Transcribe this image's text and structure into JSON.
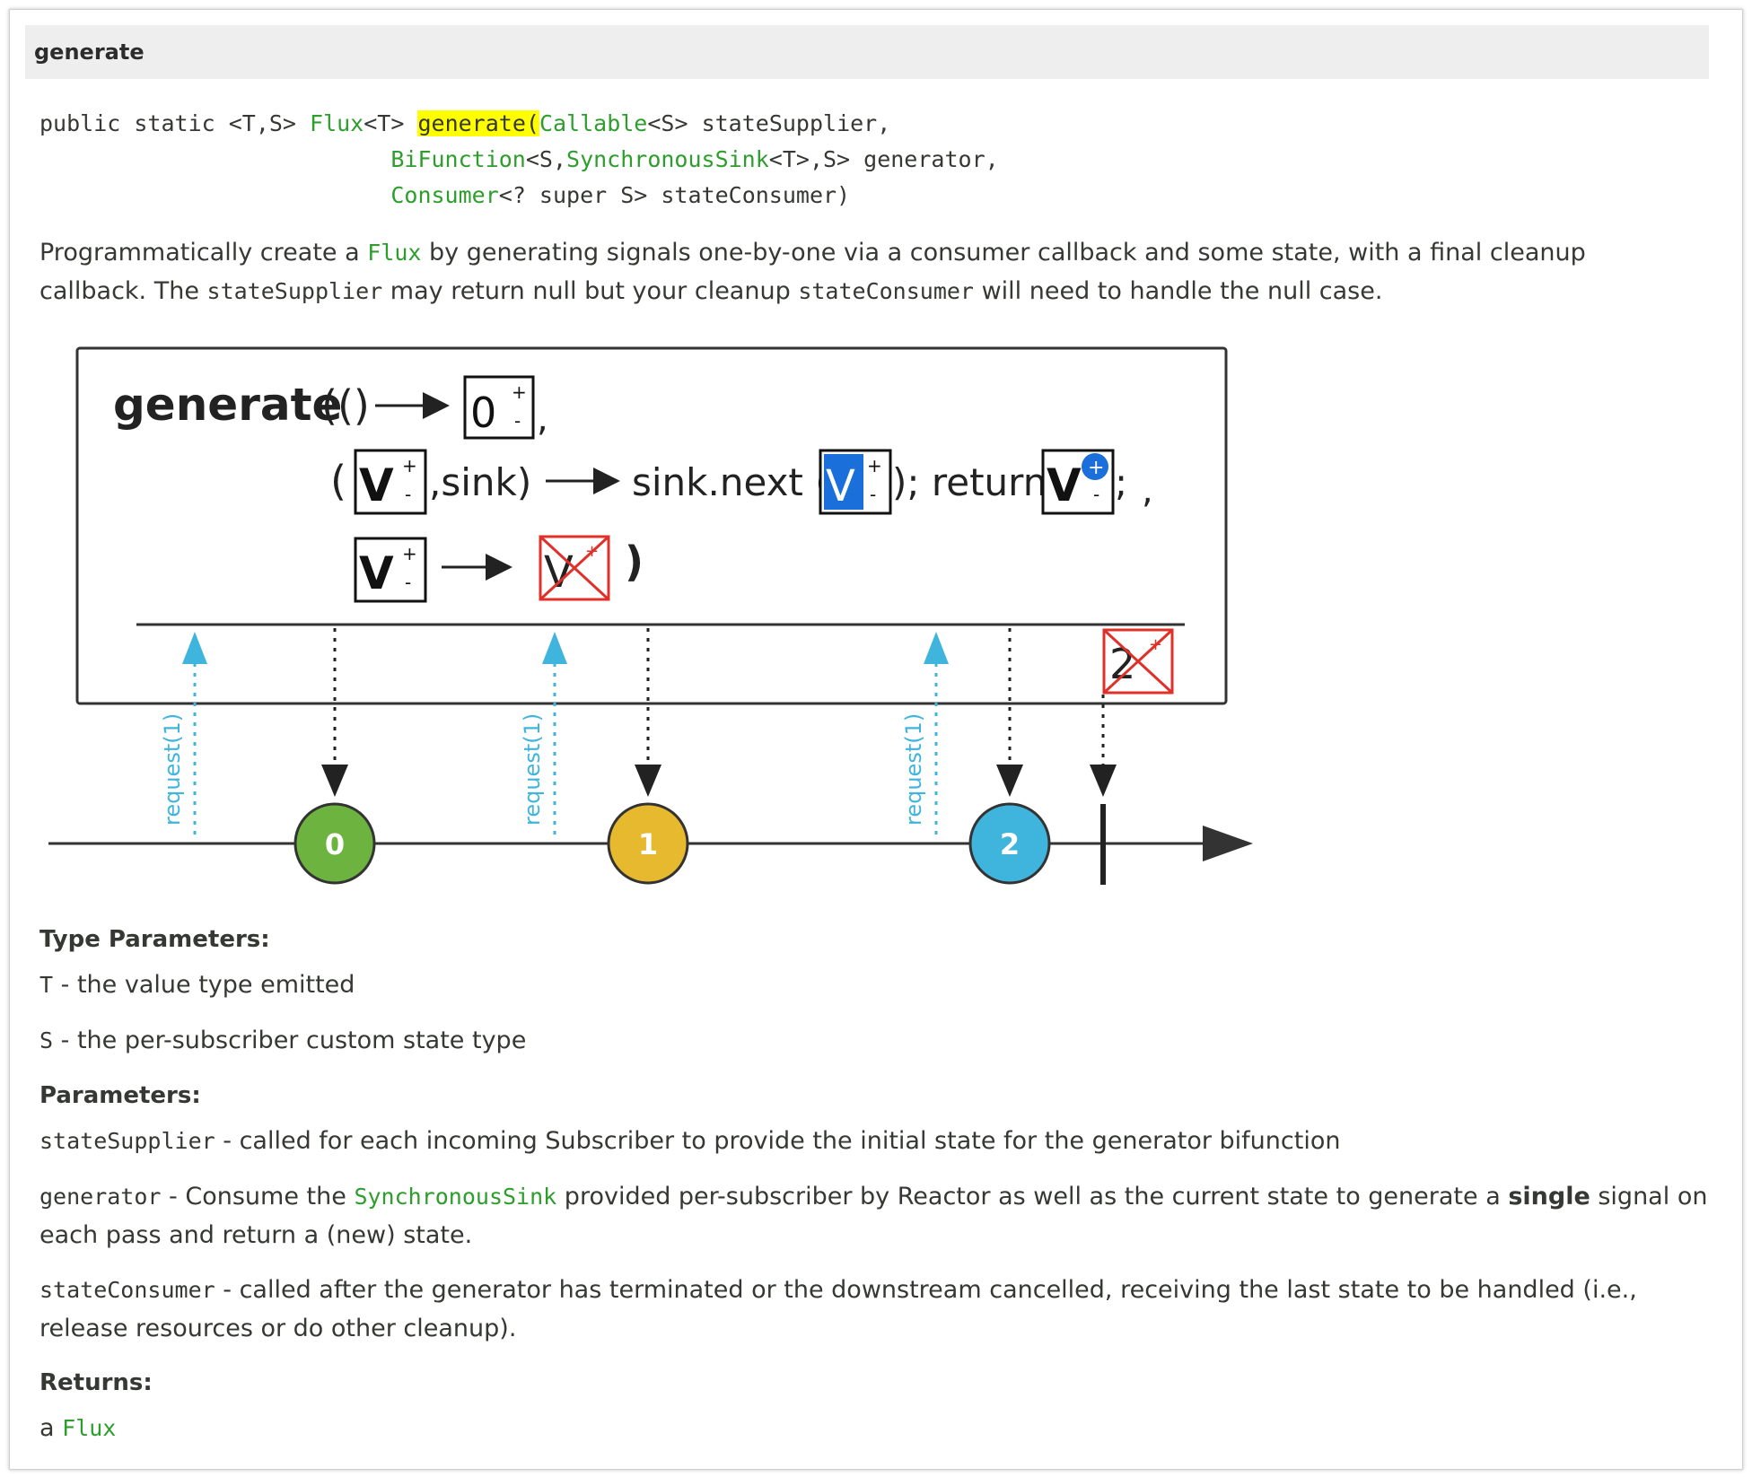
{
  "header": {
    "title": "generate"
  },
  "signature": {
    "prefix": "public static <T,S> ",
    "return_type": "Flux",
    "return_generic": "<T> ",
    "method_name": "generate(",
    "param1_type": "Callable",
    "param1_rest": "<S> stateSupplier,",
    "param2_type": "BiFunction",
    "param2_mid": "<S,",
    "param2_type2": "SynchronousSink",
    "param2_rest": "<T>,S> generator,",
    "param3_type": "Consumer",
    "param3_rest": "<? super S> stateConsumer)"
  },
  "description": {
    "part1": "Programmatically create a ",
    "flux": "Flux",
    "part2": " by generating signals one-by-one via a consumer callback and some state, with a final cleanup callback. The ",
    "code1": "stateSupplier",
    "part3": " may return null but your cleanup ",
    "code2": "stateConsumer",
    "part4": " will need to handle the null case."
  },
  "marble": {
    "title": "generate",
    "open_paren": "(()",
    "state_initial": "0",
    "plus": "+",
    "minus": "-",
    "comma": ",",
    "line2_open": "(",
    "v": "V",
    "sink": ",sink)",
    "sink_next": "sink.next (",
    "return_text": "); return",
    "semicolon": ";",
    "close_paren": ")",
    "request_label": "request(1)",
    "terminated_value": "2",
    "emissions": [
      "0",
      "1",
      "2"
    ],
    "colors": {
      "green": "#6db33f",
      "yellow": "#e6b92f",
      "blue": "#3fb4dd",
      "request": "#3fb4dd",
      "cancel": "#e0302a",
      "highlight_box": "#1a6fdb"
    }
  },
  "type_parameters": {
    "heading": "Type Parameters:",
    "items": [
      {
        "name": "T",
        "text": " - the value type emitted"
      },
      {
        "name": "S",
        "text": " - the per-subscriber custom state type"
      }
    ]
  },
  "parameters": {
    "heading": "Parameters:",
    "p1_name": "stateSupplier",
    "p1_text": " - called for each incoming Subscriber to provide the initial state for the generator bifunction",
    "p2_name": "generator",
    "p2_text1": " - Consume the ",
    "p2_link": "SynchronousSink",
    "p2_text2": " provided per-subscriber by Reactor as well as the current state to generate a ",
    "p2_bold": "single",
    "p2_text3": " signal on each pass and return a (new) state.",
    "p3_name": "stateConsumer",
    "p3_text": " - called after the generator has terminated or the downstream cancelled, receiving the last state to be handled (i.e., release resources or do other cleanup)."
  },
  "returns": {
    "heading": "Returns:",
    "prefix": "a ",
    "link": "Flux"
  }
}
